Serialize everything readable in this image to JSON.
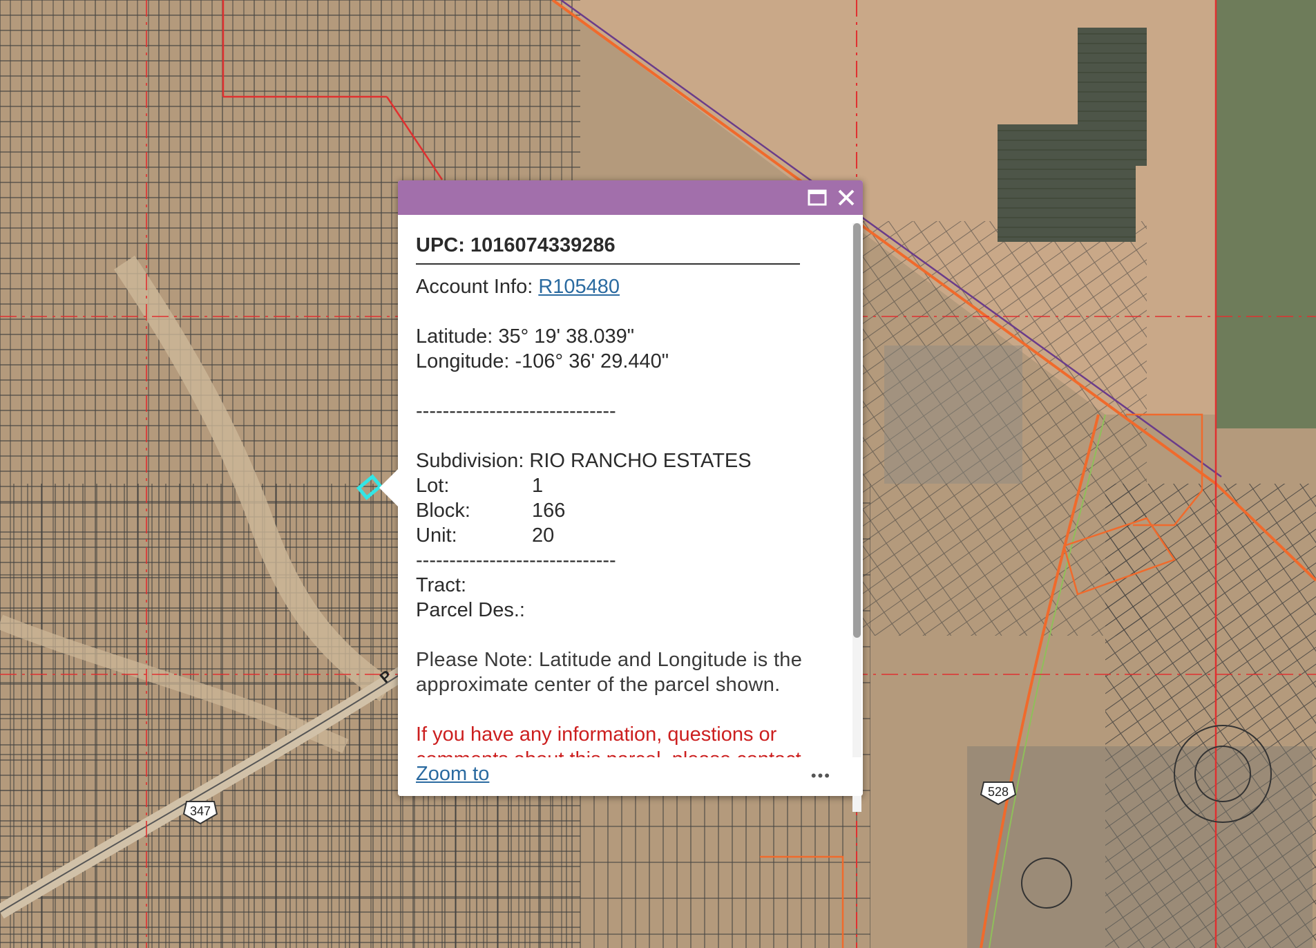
{
  "map": {
    "route_shields": [
      "347",
      "528"
    ],
    "road_letter": "P",
    "colors": {
      "terrain": "#b49a7c",
      "parcel_lines": "#3b3b3b",
      "boundary_red": "#e03030",
      "road_orange": "#f06a2c",
      "selected_parcel": "#32e6e6"
    }
  },
  "popup": {
    "header_color": "#a26fab",
    "maximize_icon": "maximize-icon",
    "close_icon": "close-icon",
    "upc": "UPC: 1016074339286",
    "account_label": "Account Info: ",
    "account_link": "R105480",
    "latitude": "Latitude: 35° 19' 38.039\"",
    "longitude": "Longitude: -106° 36' 29.440\"",
    "separator": "------------------------------",
    "subdivision": "Subdivision: RIO RANCHO ESTATES",
    "lot_label": "Lot:",
    "lot_value": "1",
    "block_label": "Block:",
    "block_value": "166",
    "unit_label": "Unit:",
    "unit_value": "20",
    "tract": "Tract:",
    "parcel_des": "Parcel Des.:",
    "note_line1": "Please Note: Latitude and Longitude is the",
    "note_line2": "approximate center of the parcel shown.",
    "warn_line1": "If you have any information, questions or",
    "warn_line2": "comments about this parcel, please contact",
    "zoom_to": "Zoom to",
    "more": "•••"
  }
}
